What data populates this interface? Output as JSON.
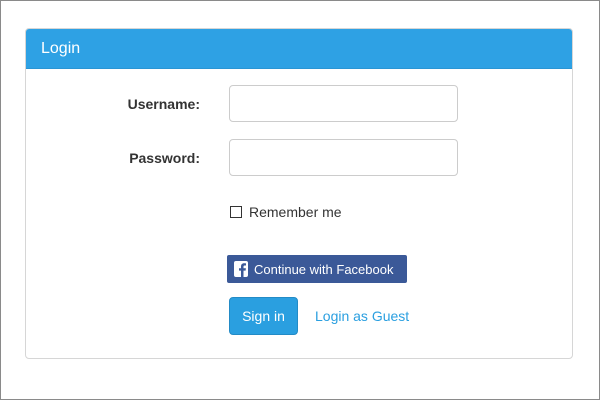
{
  "panel": {
    "title": "Login"
  },
  "form": {
    "username_label": "Username:",
    "username_value": "",
    "password_label": "Password:",
    "password_value": "",
    "remember_label": "Remember me",
    "remember_checked": false
  },
  "buttons": {
    "facebook_label": "Continue with Facebook",
    "signin_label": "Sign in",
    "guest_label": "Login as Guest"
  },
  "colors": {
    "header": "#2ea1e4",
    "primary": "#2a9fe0",
    "facebook": "#3b5998"
  },
  "icons": {
    "facebook": "facebook-f-icon",
    "checkbox": "checkbox-unchecked-icon"
  }
}
